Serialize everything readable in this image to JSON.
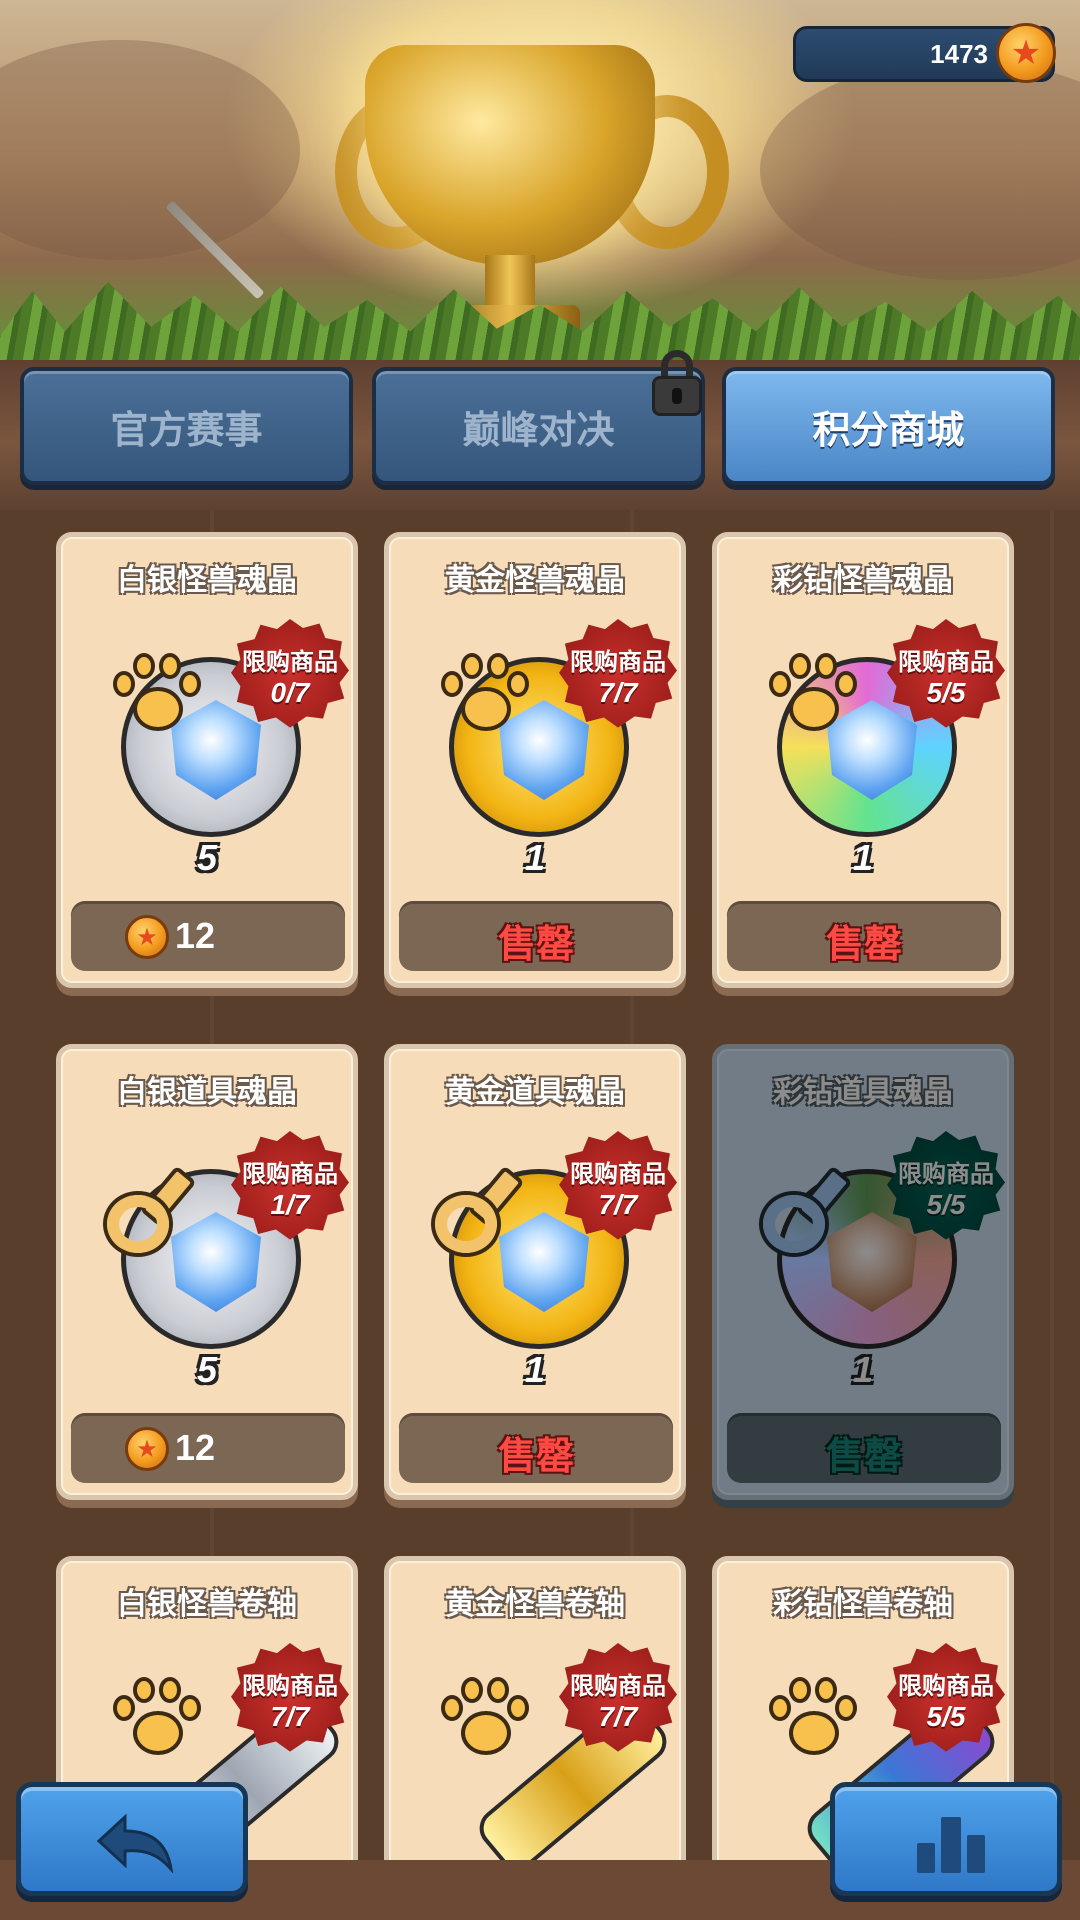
{
  "header": {
    "currency_amount": "1473",
    "currency_icon": "star-coin-icon"
  },
  "tabs": [
    {
      "label": "官方赛事",
      "active": false,
      "locked": false
    },
    {
      "label": "巅峰对决",
      "active": false,
      "locked": true
    },
    {
      "label": "积分商城",
      "active": true,
      "locked": false
    }
  ],
  "shop": {
    "limit_label": "限购商品",
    "sold_out_label": "售罄",
    "items": [
      {
        "title": "白银怪兽魂晶",
        "limit": "0/7",
        "qty": "5",
        "price": "12",
        "sold_out": false
      },
      {
        "title": "黄金怪兽魂晶",
        "limit": "7/7",
        "qty": "1",
        "price": null,
        "sold_out": true
      },
      {
        "title": "彩钻怪兽魂晶",
        "limit": "5/5",
        "qty": "1",
        "price": null,
        "sold_out": true
      },
      {
        "title": "白银道具魂晶",
        "limit": "1/7",
        "qty": "5",
        "price": "12",
        "sold_out": false
      },
      {
        "title": "黄金道具魂晶",
        "limit": "7/7",
        "qty": "1",
        "price": null,
        "sold_out": true
      },
      {
        "title": "彩钻道具魂晶",
        "limit": "5/5",
        "qty": "1",
        "price": null,
        "sold_out": true
      },
      {
        "title": "白银怪兽卷轴",
        "limit": "7/7"
      },
      {
        "title": "黄金怪兽卷轴",
        "limit": "7/7"
      },
      {
        "title": "彩钻怪兽卷轴",
        "limit": "5/5"
      }
    ]
  },
  "footer": {
    "back_icon": "back-arrow-icon",
    "rank_icon": "leaderboard-icon"
  },
  "colors": {
    "accent": "#4a86c6",
    "sold_out": "#ff4a44",
    "badge": "#c9302c"
  }
}
